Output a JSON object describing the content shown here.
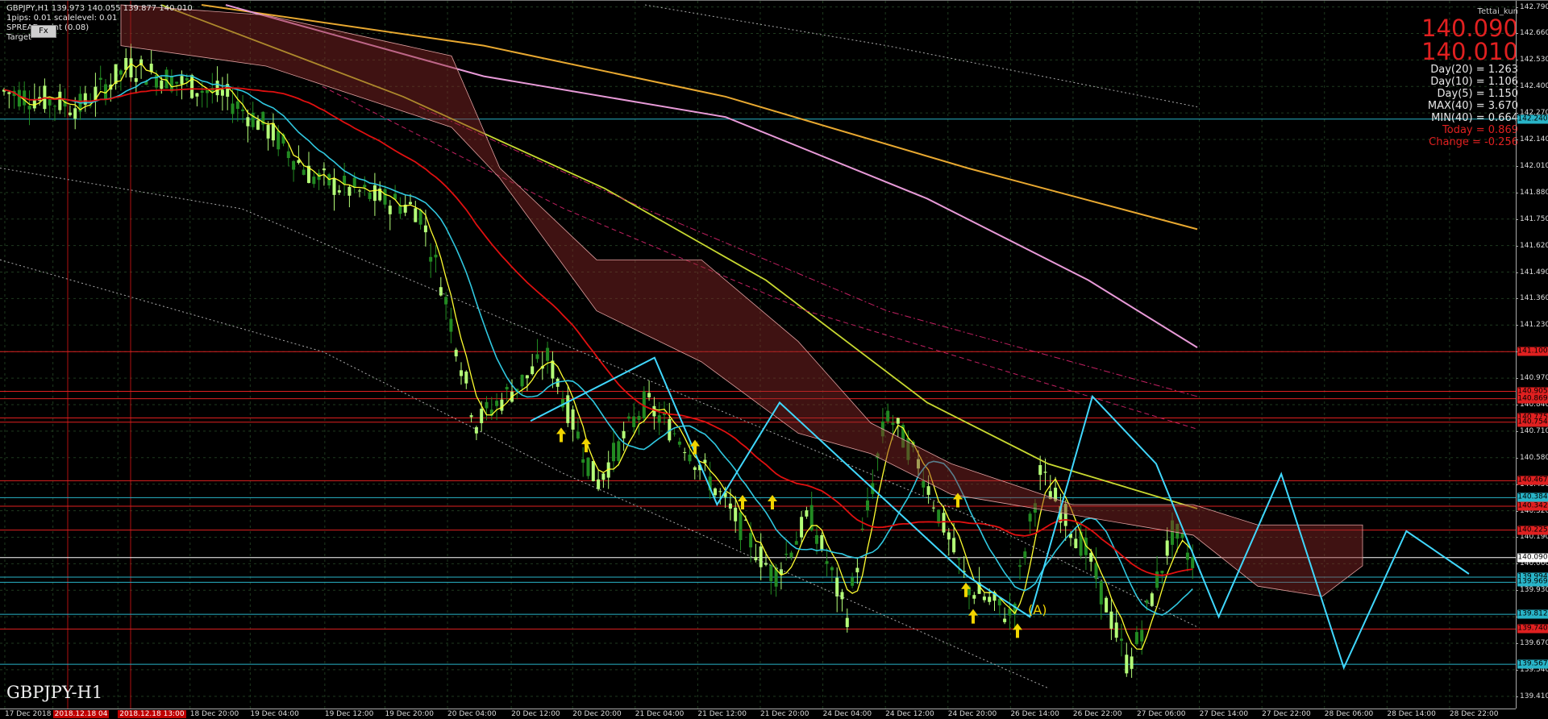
{
  "window": {
    "symbol_line": "GBPJPY,H1  139.973 140.055 139.877 140.010",
    "settings_line": "1pips: 0.01 scalelevel: 0.01",
    "spread_line": "SPREAD point (0.08)",
    "target_line": "Target",
    "watermark": "GBPJPY-H1",
    "fx_button": "Fx"
  },
  "info_panel": {
    "user": "Tettai_kun",
    "bid": "140.090",
    "ask": "140.010",
    "stats": [
      {
        "text": "Day(20) = 1.263",
        "color": "#e8e8e8"
      },
      {
        "text": "Day(10) = 1.106",
        "color": "#e8e8e8"
      },
      {
        "text": "Day(5) = 1.150",
        "color": "#e8e8e8"
      },
      {
        "text": "MAX(40) = 3.670",
        "color": "#e8e8e8"
      },
      {
        "text": "MIN(40) = 0.664",
        "color": "#e8e8e8"
      },
      {
        "text": "Today = 0.869",
        "color": "#e02020"
      },
      {
        "text": "Change = -0.256",
        "color": "#e02020"
      }
    ]
  },
  "annotation_label": "(A)",
  "price_axis": {
    "ticks": [
      "142.790",
      "142.660",
      "142.530",
      "142.400",
      "142.270",
      "142.140",
      "142.010",
      "141.880",
      "141.750",
      "141.620",
      "141.490",
      "141.360",
      "141.230",
      "141.100",
      "140.970",
      "140.840",
      "140.710",
      "140.580",
      "140.450",
      "140.320",
      "140.190",
      "140.060",
      "139.930",
      "139.800",
      "139.670",
      "139.540",
      "139.410"
    ],
    "labels": [
      {
        "price": 142.24,
        "text": "142.240",
        "bg": "#28b4c8"
      },
      {
        "price": 141.1,
        "text": "141.100",
        "bg": "#e02020"
      },
      {
        "price": 140.905,
        "text": "140.905",
        "bg": "#e02020"
      },
      {
        "price": 140.869,
        "text": "140.869",
        "bg": "#e02020"
      },
      {
        "price": 140.775,
        "text": "140.775",
        "bg": "#e02020"
      },
      {
        "price": 140.754,
        "text": "140.754",
        "bg": "#e02020"
      },
      {
        "price": 140.467,
        "text": "140.467",
        "bg": "#e02020"
      },
      {
        "price": 140.384,
        "text": "140.384",
        "bg": "#28b4c8"
      },
      {
        "price": 140.342,
        "text": "140.342",
        "bg": "#e02020"
      },
      {
        "price": 140.225,
        "text": "140.225",
        "bg": "#e02020"
      },
      {
        "price": 140.09,
        "text": "140.090",
        "bg": "#ffffff"
      },
      {
        "price": 139.994,
        "text": "139.994",
        "bg": "#28b4c8"
      },
      {
        "price": 139.969,
        "text": "139.969",
        "bg": "#28b4c8"
      },
      {
        "price": 139.812,
        "text": "139.812",
        "bg": "#28b4c8"
      },
      {
        "price": 139.74,
        "text": "139.740",
        "bg": "#e02020"
      },
      {
        "price": 139.567,
        "text": "139.567",
        "bg": "#28b4c8"
      }
    ]
  },
  "time_axis": {
    "labels": [
      {
        "text": "17 Dec 2018",
        "hl": false
      },
      {
        "text": "2018.12.18 04",
        "hl": true
      },
      {
        "text": "2018.12.18 13:00",
        "hl": true
      },
      {
        "text": "18 Dec 20:00",
        "hl": false
      },
      {
        "text": "19 Dec 04:00",
        "hl": false
      },
      {
        "text": "19 Dec 12:00",
        "hl": false
      },
      {
        "text": "19 Dec 20:00",
        "hl": false
      },
      {
        "text": "20 Dec 04:00",
        "hl": false
      },
      {
        "text": "20 Dec 12:00",
        "hl": false
      },
      {
        "text": "20 Dec 20:00",
        "hl": false
      },
      {
        "text": "21 Dec 04:00",
        "hl": false
      },
      {
        "text": "21 Dec 12:00",
        "hl": false
      },
      {
        "text": "21 Dec 20:00",
        "hl": false
      },
      {
        "text": "24 Dec 04:00",
        "hl": false
      },
      {
        "text": "24 Dec 12:00",
        "hl": false
      },
      {
        "text": "24 Dec 20:00",
        "hl": false
      },
      {
        "text": "26 Dec 14:00",
        "hl": false
      },
      {
        "text": "26 Dec 22:00",
        "hl": false
      },
      {
        "text": "27 Dec 06:00",
        "hl": false
      },
      {
        "text": "27 Dec 14:00",
        "hl": false
      },
      {
        "text": "27 Dec 22:00",
        "hl": false
      },
      {
        "text": "28 Dec 06:00",
        "hl": false
      },
      {
        "text": "28 Dec 14:00",
        "hl": false
      },
      {
        "text": "28 Dec 22:00",
        "hl": false
      }
    ]
  },
  "chart_data": {
    "type": "candlestick",
    "symbol": "GBPJPY",
    "timeframe": "H1",
    "last_bar": {
      "open": 139.973,
      "high": 140.055,
      "low": 139.877,
      "close": 140.01
    },
    "ylim": [
      139.35,
      142.82
    ],
    "colors": {
      "bull_candle": "#b4ff78",
      "bear_candle": "#228b22",
      "ma_fast": "#ffff30",
      "ma_mid": "#30c8e0",
      "ma_slow": "#e01010",
      "ma_long": "#c8d830",
      "ma_200": "#e89ad8",
      "ma_400": "#e8a830",
      "zigzag": "#40d8ff",
      "kumo": "#a04040",
      "arrow": "#f0d400"
    },
    "zigzag_pivots": [
      {
        "x": "20 Dec 12:00",
        "y": 140.76
      },
      {
        "x": "21 Dec 04:00",
        "y": 141.07
      },
      {
        "x": "21 Dec 12:00",
        "y": 140.35
      },
      {
        "x": "21 Dec 20:00",
        "y": 140.85
      },
      {
        "x": "24 Dec 20:00",
        "y": 140.0
      },
      {
        "x": "26 Dec 14:00",
        "y": 139.8
      },
      {
        "x": "26 Dec 22:00",
        "y": 140.88
      },
      {
        "x": "27 Dec 06:00",
        "y": 140.55
      },
      {
        "x": "27 Dec 14:00",
        "y": 139.8
      },
      {
        "x": "27 Dec 22:00",
        "y": 140.5
      },
      {
        "x": "28 Dec 06:00",
        "y": 139.55
      },
      {
        "x": "28 Dec 14:00",
        "y": 140.22
      },
      {
        "x": "28 Dec 22:00",
        "y": 140.01
      }
    ]
  }
}
